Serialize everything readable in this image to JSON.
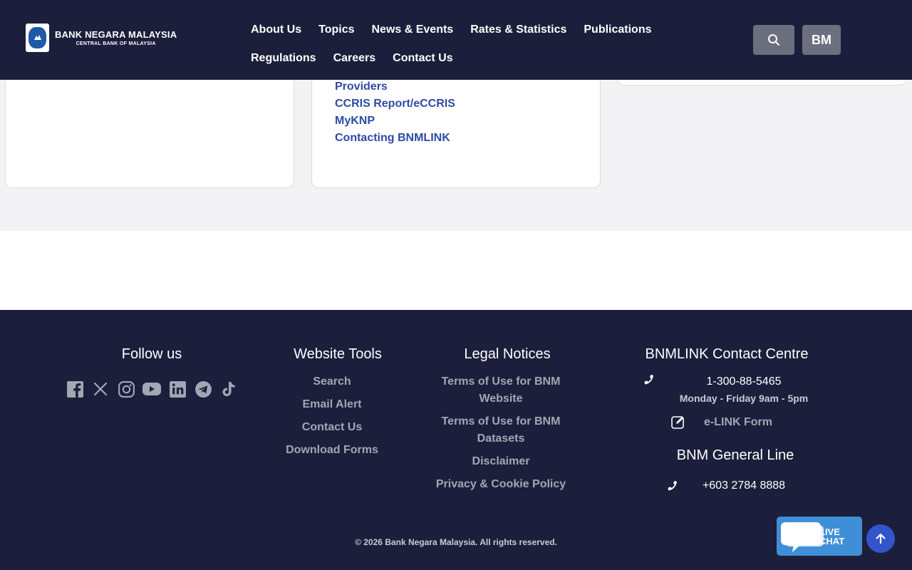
{
  "header": {
    "logo": {
      "title": "BANK NEGARA MALAYSIA",
      "subtitle": "CENTRAL BANK OF MALAYSIA"
    },
    "nav_row1": [
      "About Us",
      "Topics",
      "News & Events",
      "Rates & Statistics",
      "Publications"
    ],
    "nav_row2": [
      "Regulations",
      "Careers",
      "Contact Us"
    ],
    "search_icon": "search-icon",
    "language_label": "BM"
  },
  "cards": {
    "middle_links": [
      "Providers",
      "CCRIS Report/eCCRIS",
      "MyKNP",
      "Contacting BNMLINK"
    ]
  },
  "footer": {
    "follow_us": {
      "heading": "Follow us",
      "icons": [
        "facebook-icon",
        "x-icon",
        "instagram-icon",
        "youtube-icon",
        "linkedin-icon",
        "telegram-icon",
        "tiktok-icon"
      ]
    },
    "website_tools": {
      "heading": "Website Tools",
      "links": [
        "Search",
        "Email Alert",
        "Contact Us",
        "Download Forms"
      ]
    },
    "legal_notices": {
      "heading": "Legal Notices",
      "links": [
        "Terms of Use for BNM Website",
        "Terms of Use for BNM Datasets",
        "Disclaimer",
        "Privacy & Cookie Policy"
      ]
    },
    "contact_centre": {
      "heading": "BNMLINK Contact Centre",
      "phone": "1-300-88-5465",
      "hours": "Monday - Friday 9am - 5pm",
      "form_label": "e-LINK Form"
    },
    "general_line": {
      "heading": "BNM General Line",
      "phone": "+603 2784 8888"
    },
    "copyright": "© 2026 Bank Negara Malaysia. All rights reserved."
  },
  "widgets": {
    "live_chat_line1": "LIVE",
    "live_chat_line2": "CHAT"
  },
  "colors": {
    "navy": "#1c1f3b",
    "link_blue": "#2f4ba3",
    "muted_button": "#6c6f7d",
    "live_chat": "#3f8fd6",
    "scroll_top": "#3355cc"
  }
}
